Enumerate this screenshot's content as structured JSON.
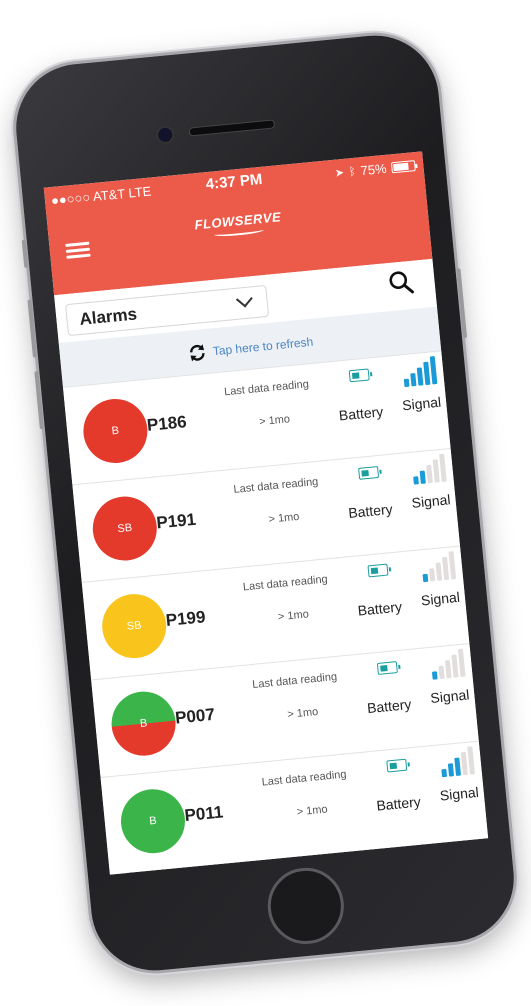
{
  "status_bar": {
    "carrier": "●●○○○ AT&T  LTE",
    "time": "4:37 PM",
    "battery_percent": "75%"
  },
  "header": {
    "logo": "FLOWSERVE",
    "menu_icon": "hamburger-icon"
  },
  "toolbar": {
    "filter_value": "Alarms",
    "search_icon": "search-icon"
  },
  "refresh": {
    "label": "Tap here to refresh",
    "icon": "refresh-icon"
  },
  "colors": {
    "header": "#ec5b4a",
    "red": "#e33a2c",
    "yellow": "#f9c41b",
    "green": "#3bb54a",
    "accent_blue": "#1a9ad6",
    "link_blue": "#4a86c5"
  },
  "pumps": [
    {
      "id": "P186",
      "status_code": "B",
      "status_color": "red",
      "reading_label": "Last data reading",
      "reading_age": "> 1mo",
      "battery_label": "Battery",
      "signal_label": "Signal",
      "signal_level": 5
    },
    {
      "id": "P191",
      "status_code": "SB",
      "status_color": "red",
      "reading_label": "Last data reading",
      "reading_age": "> 1mo",
      "battery_label": "Battery",
      "signal_label": "Signal",
      "signal_level": 2
    },
    {
      "id": "P199",
      "status_code": "SB",
      "status_color": "yellow",
      "reading_label": "Last data reading",
      "reading_age": "> 1mo",
      "battery_label": "Battery",
      "signal_label": "Signal",
      "signal_level": 1
    },
    {
      "id": "P007",
      "status_code": "B",
      "status_color": "green-red",
      "reading_label": "Last data reading",
      "reading_age": "> 1mo",
      "battery_label": "Battery",
      "signal_label": "Signal",
      "signal_level": 1
    },
    {
      "id": "P011",
      "status_code": "B",
      "status_color": "green",
      "reading_label": "Last data reading",
      "reading_age": "> 1mo",
      "battery_label": "Battery",
      "signal_label": "Signal",
      "signal_level": 3
    }
  ]
}
